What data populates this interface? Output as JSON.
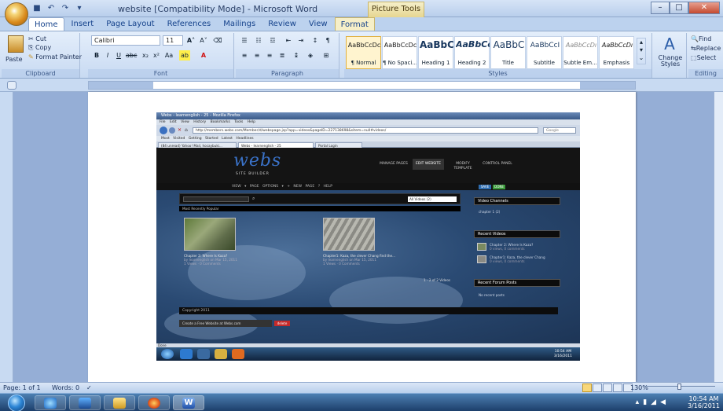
{
  "window": {
    "title": "website [Compatibility Mode] - Microsoft Word",
    "context_tab_group": "Picture Tools",
    "controls": {
      "minimize": "–",
      "maximize": "□",
      "close": "✕"
    }
  },
  "ribbon_tabs": [
    "Home",
    "Insert",
    "Page Layout",
    "References",
    "Mailings",
    "Review",
    "View",
    "Format"
  ],
  "active_tab": "Home",
  "clipboard": {
    "paste": "Paste",
    "cut": "Cut",
    "copy": "Copy",
    "format_painter": "Format Painter",
    "label": "Clipboard"
  },
  "font": {
    "name": "Calibri",
    "size": "11",
    "label": "Font"
  },
  "paragraph": {
    "label": "Paragraph"
  },
  "styles": {
    "label": "Styles",
    "items": [
      {
        "sample": "AaBbCcDc",
        "name": "¶ Normal"
      },
      {
        "sample": "AaBbCcDc",
        "name": "¶ No Spaci..."
      },
      {
        "sample": "AaBbC",
        "name": "Heading 1"
      },
      {
        "sample": "AaBbCc",
        "name": "Heading 2"
      },
      {
        "sample": "AaBbC",
        "name": "Title"
      },
      {
        "sample": "AaBbCcI",
        "name": "Subtitle"
      },
      {
        "sample": "AaBbCcDı",
        "name": "Subtle Em..."
      },
      {
        "sample": "AaBbCcDı",
        "name": "Emphasis"
      }
    ],
    "change_styles": "Change Styles"
  },
  "editing": {
    "find": "Find",
    "replace": "Replace",
    "select": "Select",
    "label": "Editing"
  },
  "status_bar": {
    "page": "Page: 1 of 1",
    "words": "Words: 0",
    "zoom": "130%"
  },
  "taskbar": {
    "time": "10:54 AM",
    "date": "3/16/2011"
  },
  "embedded_screenshot": {
    "browser_title": "Webs - learnenglish - 25 - Mozilla Firefox",
    "menu": "File Edit View History Bookmarks Tools Help",
    "url": "http://members.webs.com/Member/d/webspage.jsp?app=videos&pageID=227138698&sitem=null#videos/",
    "search_placeholder": "Google",
    "bookmarks": "Most Visited   Getting Started   Latest Headlines",
    "tabs": [
      "(84 unread) Yahoo! Mail, hocaybuki...",
      "Webs - learnenglish - 25",
      "Portal Login"
    ],
    "logo": "webs",
    "logo_sub": "SITE BUILDER",
    "nav": [
      "MANAGE PAGES",
      "EDIT WEBSITE",
      "MODIFY TEMPLATE",
      "CONTROL PANEL"
    ],
    "toolbar": "VIEW ▾   PAGE OPTIONS ▾   + NEW PAGE   ? HELP",
    "toolbar_buttons": [
      "SAVE",
      "DONE"
    ],
    "video_select": "All Videos (2)",
    "videos_tab": "Most Recently Popular",
    "videos": [
      {
        "title": "Chapter 2: Where Is Kaza?",
        "meta": "by learnenglish on Mar 15, 2011",
        "stats": "1 Views · 0 Comments"
      },
      {
        "title": "Chapter1: Kaza, the clever Chang find the...",
        "meta": "by learnenglish on Mar 15, 2011",
        "stats": "1 Views · 0 Comments"
      }
    ],
    "count": "1 - 2 of 2 Videos",
    "sidebar": {
      "channels_title": "Video Channels",
      "channels_link": "chapter 1 (2)",
      "recent_title": "Recent Videos",
      "recent": [
        "Chapter 2: Where Is Kaza?",
        "0 views, 0 comments",
        "Chapter1: Kaza, the clever Chang",
        "0 views, 0 comments"
      ],
      "forum_title": "Recent Forum Posts",
      "forum_empty": "No recent posts"
    },
    "copyright": "Copyright 2011",
    "free_bar": "Create a Free Website at Webs.com",
    "free_btn": "delete",
    "status": "Done",
    "clock_time": "10:54 AM",
    "clock_date": "3/16/2011"
  }
}
